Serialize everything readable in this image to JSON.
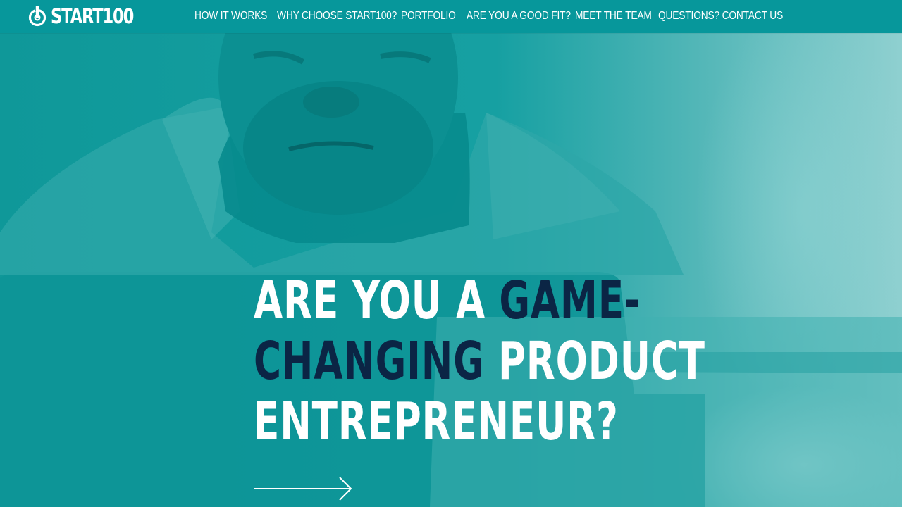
{
  "brand": {
    "name": "START100"
  },
  "nav": {
    "items": [
      "HOW IT WORKS",
      "WHY CHOOSE START100?",
      "PORTFOLIO",
      "ARE YOU A GOOD FIT?",
      "MEET THE TEAM",
      "QUESTIONS? CONTACT US"
    ]
  },
  "hero": {
    "line1_white": "ARE YOU A ",
    "line1_dark": "GAME-",
    "line2_dark": "CHANGING",
    "line2_white": " PRODUCT",
    "line3_white": "ENTREPRENEUR?"
  },
  "colors": {
    "nav_bg": "#07979b",
    "hero_tint": "#109a9c",
    "accent_dark": "#0b2545",
    "text": "#ffffff"
  },
  "icons": {
    "logo": "power-icon",
    "cta": "arrow-right-icon"
  }
}
